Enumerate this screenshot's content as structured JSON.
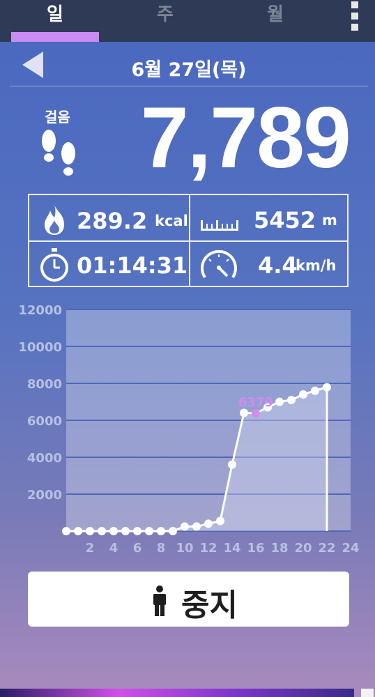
{
  "tabs": [
    {
      "label": "일",
      "active": true
    },
    {
      "label": "주",
      "active": false
    },
    {
      "label": "월",
      "active": false
    }
  ],
  "date": {
    "title": "6월 27일(목)"
  },
  "steps": {
    "label": "걸음",
    "value": "7,789"
  },
  "stats": {
    "calories": {
      "value": "289.2",
      "unit": "kcal",
      "icon": "flame-icon"
    },
    "distance": {
      "value": "5452",
      "unit": "m",
      "icon": "ruler-icon"
    },
    "duration": {
      "value": "01:14:31",
      "icon": "stopwatch-icon"
    },
    "speed": {
      "value": "4.4",
      "unit": "km/h",
      "icon": "speedometer-icon"
    }
  },
  "chart_data": {
    "type": "area",
    "x_ticks": [
      "2",
      "4",
      "6",
      "8",
      "10",
      "12",
      "14",
      "16",
      "18",
      "20",
      "22",
      "24"
    ],
    "y_ticks": [
      "2000",
      "4000",
      "6000",
      "8000",
      "10000",
      "12000"
    ],
    "xlim": [
      0,
      24
    ],
    "ylim": [
      0,
      12000
    ],
    "x": [
      0,
      1,
      2,
      3,
      4,
      5,
      6,
      7,
      8,
      9,
      10,
      11,
      12,
      13,
      14,
      15,
      16,
      17,
      18,
      19,
      20,
      21,
      22
    ],
    "values": [
      0,
      0,
      0,
      0,
      0,
      0,
      0,
      0,
      0,
      0,
      250,
      250,
      400,
      550,
      3600,
      6400,
      6379,
      6700,
      7000,
      7100,
      7400,
      7600,
      7789
    ],
    "highlight": {
      "x": 16,
      "label": "6379"
    },
    "colors": {
      "line": "#ffffff",
      "highlight": "#d08cf0"
    }
  },
  "stop_button": {
    "label": "중지",
    "icon": "person-icon"
  },
  "colors": {
    "tabbar": "#2f3a56",
    "tab_indicator": "#c98cf2"
  }
}
